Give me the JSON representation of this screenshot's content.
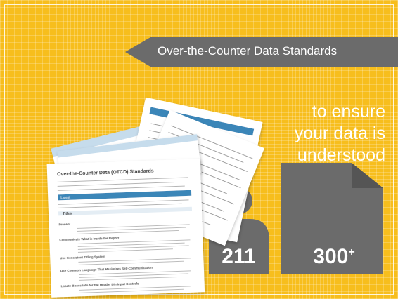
{
  "banner": {
    "title": "Over-the-Counter Data Standards"
  },
  "tagline": [
    "to ensure",
    "your data is",
    "understood"
  ],
  "document": {
    "title": "Over-the-Counter Data (OTCD) Standards",
    "section_label": "Latest",
    "subheading": "Titles",
    "items": [
      "Present",
      "Communicate What is Inside the Report",
      "Use Consistent Titling System",
      "Use Common Language That Maximizes Self-Communication",
      "Locate Boxes Info for the Header Bin Input Controls"
    ]
  },
  "stats": {
    "first": "211",
    "second": "300",
    "second_suffix": "+"
  },
  "colors": {
    "background": "#f7be1d",
    "banner": "#6b6b6b",
    "accent": "#3a86b8",
    "text": "#ffffff"
  }
}
